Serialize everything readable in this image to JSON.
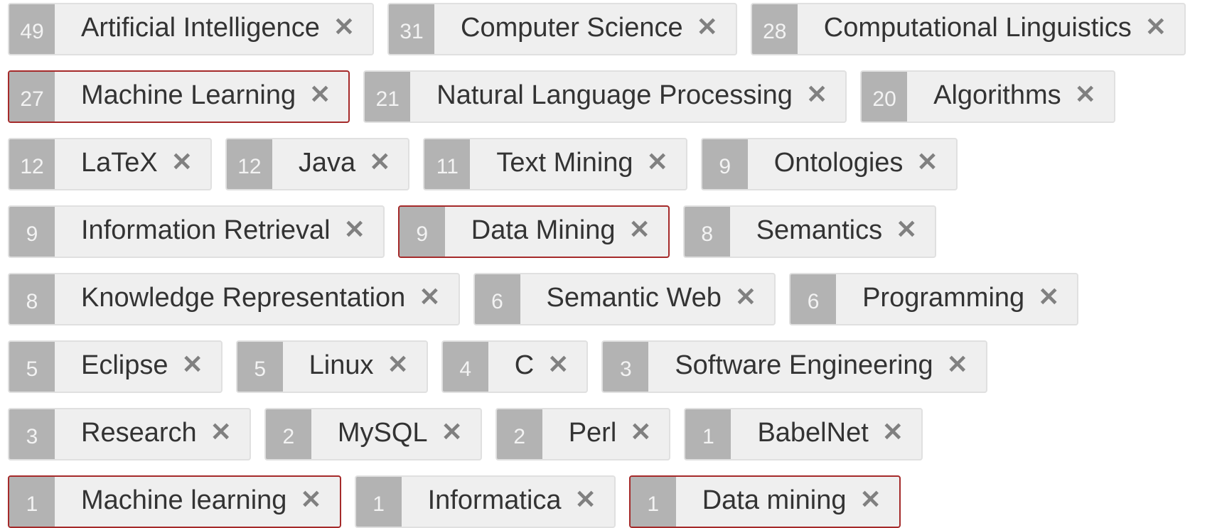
{
  "tag_rows": [
    [
      {
        "count": "49",
        "label": "Artificial Intelligence",
        "highlight": false
      },
      {
        "count": "31",
        "label": "Computer Science",
        "highlight": false
      },
      {
        "count": "28",
        "label": "Computational Linguistics",
        "highlight": false
      }
    ],
    [
      {
        "count": "27",
        "label": "Machine Learning",
        "highlight": true
      },
      {
        "count": "21",
        "label": "Natural Language Processing",
        "highlight": false
      },
      {
        "count": "20",
        "label": "Algorithms",
        "highlight": false
      }
    ],
    [
      {
        "count": "12",
        "label": "LaTeX",
        "highlight": false
      },
      {
        "count": "12",
        "label": "Java",
        "highlight": false
      },
      {
        "count": "11",
        "label": "Text Mining",
        "highlight": false
      },
      {
        "count": "9",
        "label": "Ontologies",
        "highlight": false
      }
    ],
    [
      {
        "count": "9",
        "label": "Information Retrieval",
        "highlight": false
      },
      {
        "count": "9",
        "label": "Data Mining",
        "highlight": true
      },
      {
        "count": "8",
        "label": "Semantics",
        "highlight": false
      }
    ],
    [
      {
        "count": "8",
        "label": "Knowledge Representation",
        "highlight": false
      },
      {
        "count": "6",
        "label": "Semantic Web",
        "highlight": false
      },
      {
        "count": "6",
        "label": "Programming",
        "highlight": false
      }
    ],
    [
      {
        "count": "5",
        "label": "Eclipse",
        "highlight": false
      },
      {
        "count": "5",
        "label": "Linux",
        "highlight": false
      },
      {
        "count": "4",
        "label": "C",
        "highlight": false
      },
      {
        "count": "3",
        "label": "Software Engineering",
        "highlight": false
      }
    ],
    [
      {
        "count": "3",
        "label": "Research",
        "highlight": false
      },
      {
        "count": "2",
        "label": "MySQL",
        "highlight": false
      },
      {
        "count": "2",
        "label": "Perl",
        "highlight": false
      },
      {
        "count": "1",
        "label": "BabelNet",
        "highlight": false
      }
    ],
    [
      {
        "count": "1",
        "label": "Machine learning",
        "highlight": true
      },
      {
        "count": "1",
        "label": "Informatica",
        "highlight": false
      },
      {
        "count": "1",
        "label": "Data mining",
        "highlight": true
      }
    ]
  ],
  "remove_glyph": "✕",
  "remove_icon_name": "close-icon",
  "colors": {
    "count_background": "#b3b3b3",
    "tag_background": "#efefef",
    "highlight_border": "#a52a2a",
    "label_text": "#333333",
    "remove_icon": "#808080"
  }
}
